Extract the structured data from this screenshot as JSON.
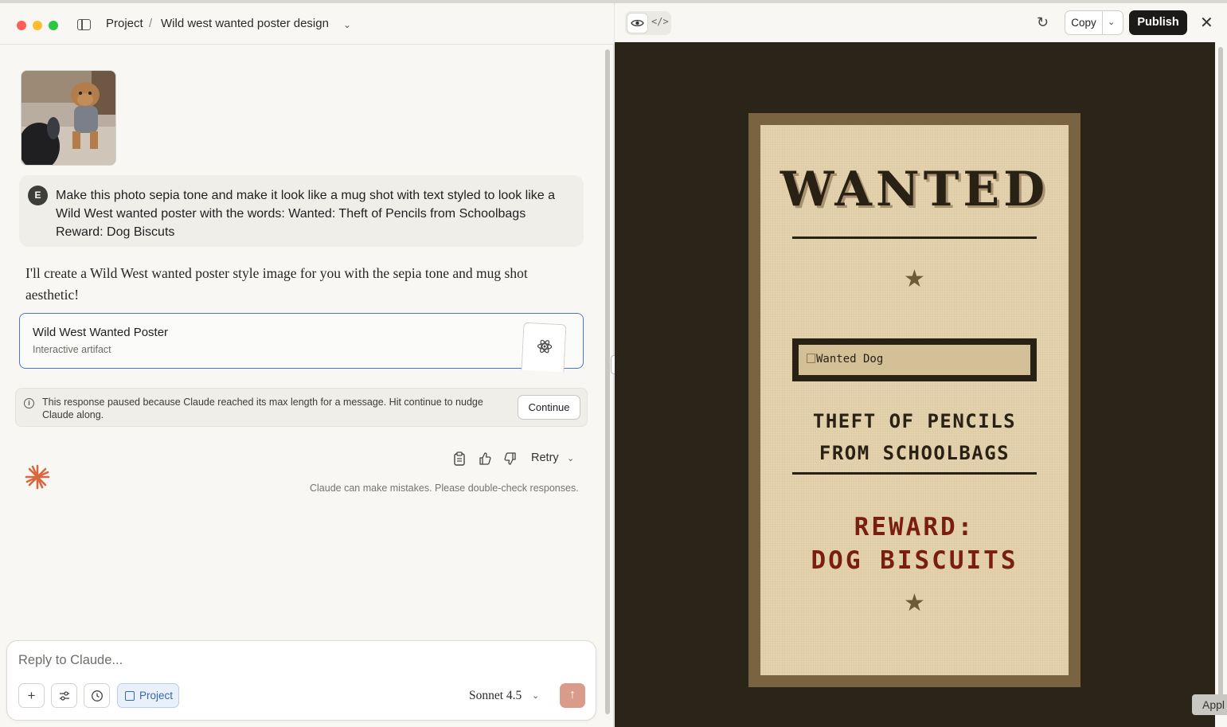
{
  "breadcrumb": {
    "project": "Project",
    "separator": "/",
    "title": "Wild west wanted poster design"
  },
  "user_message": {
    "avatar_initial": "E",
    "text": "Make this photo sepia tone and make it look like a mug shot with text styled to look like a Wild West wanted poster with the words: Wanted: Theft of Pencils from Schoolbags  Reward: Dog Biscuts"
  },
  "assistant": {
    "text": "I'll create a Wild West wanted poster style image for you with the sepia tone and mug shot aesthetic!"
  },
  "artifact_card": {
    "title": "Wild West Wanted Poster",
    "subtitle": "Interactive artifact"
  },
  "notice": {
    "text": "This response paused because Claude reached its max length for a message. Hit continue to nudge Claude along.",
    "continue_label": "Continue"
  },
  "message_actions": {
    "retry_label": "Retry",
    "disclaimer": "Claude can make mistakes. Please double-check responses."
  },
  "composer": {
    "placeholder": "Reply to Claude...",
    "project_label": "Project",
    "model": "Sonnet 4.5"
  },
  "preview_toolbar": {
    "copy_label": "Copy",
    "publish_label": "Publish"
  },
  "poster": {
    "heading": "WANTED",
    "image_alt": "Wanted Dog",
    "crime_line1": "THEFT OF PENCILS",
    "crime_line2": "FROM SCHOOLBAGS",
    "reward_line1": "REWARD:",
    "reward_line2": "DOG BISCUITS",
    "star": "★"
  },
  "background_app": {
    "button_label": "Appl"
  },
  "colors": {
    "accent_blue": "#4a78c8",
    "publish_bg": "#1b1a18",
    "send_bg": "#d99c8a",
    "poster_paper": "#e3d2ac",
    "poster_frame": "#7a6341",
    "reward_red": "#7a1e10",
    "preview_bg": "#2a2419",
    "claude_spark": "#d6673f"
  }
}
